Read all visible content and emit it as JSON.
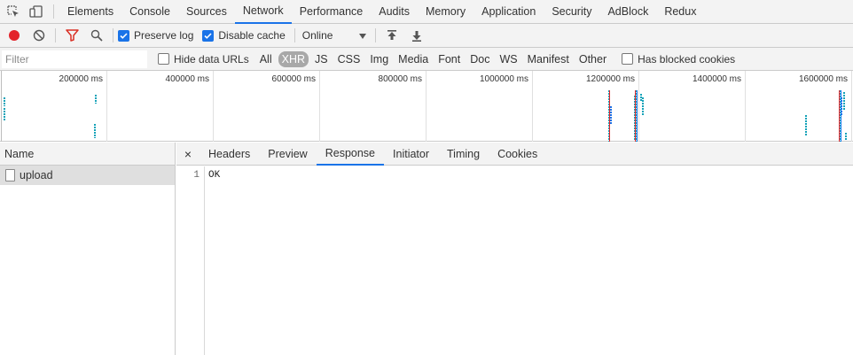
{
  "tabs": [
    "Elements",
    "Console",
    "Sources",
    "Network",
    "Performance",
    "Audits",
    "Memory",
    "Application",
    "Security",
    "AdBlock",
    "Redux"
  ],
  "active_tab": "Network",
  "toolbar": {
    "preserve_log": {
      "label": "Preserve log",
      "checked": true
    },
    "disable_cache": {
      "label": "Disable cache",
      "checked": true
    },
    "throttle": "Online"
  },
  "filterbar": {
    "filter_placeholder": "Filter",
    "hide_data_urls": {
      "label": "Hide data URLs",
      "checked": false
    },
    "types": [
      "All",
      "XHR",
      "JS",
      "CSS",
      "Img",
      "Media",
      "Font",
      "Doc",
      "WS",
      "Manifest",
      "Other"
    ],
    "active_type": "XHR",
    "has_blocked_cookies": {
      "label": "Has blocked cookies",
      "checked": false
    }
  },
  "overview": {
    "ticks": [
      "200000 ms",
      "400000 ms",
      "600000 ms",
      "800000 ms",
      "1000000 ms",
      "1200000 ms",
      "1400000 ms",
      "1600000 ms"
    ]
  },
  "requests": {
    "header": "Name",
    "items": [
      {
        "name": "upload"
      }
    ]
  },
  "details": {
    "tabs": [
      "Headers",
      "Preview",
      "Response",
      "Initiator",
      "Timing",
      "Cookies"
    ],
    "active_tab": "Response",
    "lines": [
      {
        "number": "1",
        "text": "OK"
      }
    ]
  },
  "colors": {
    "accent": "#1a73e8",
    "record": "#e3242b",
    "filter": "#d93025",
    "teal": "#13a2b8"
  }
}
